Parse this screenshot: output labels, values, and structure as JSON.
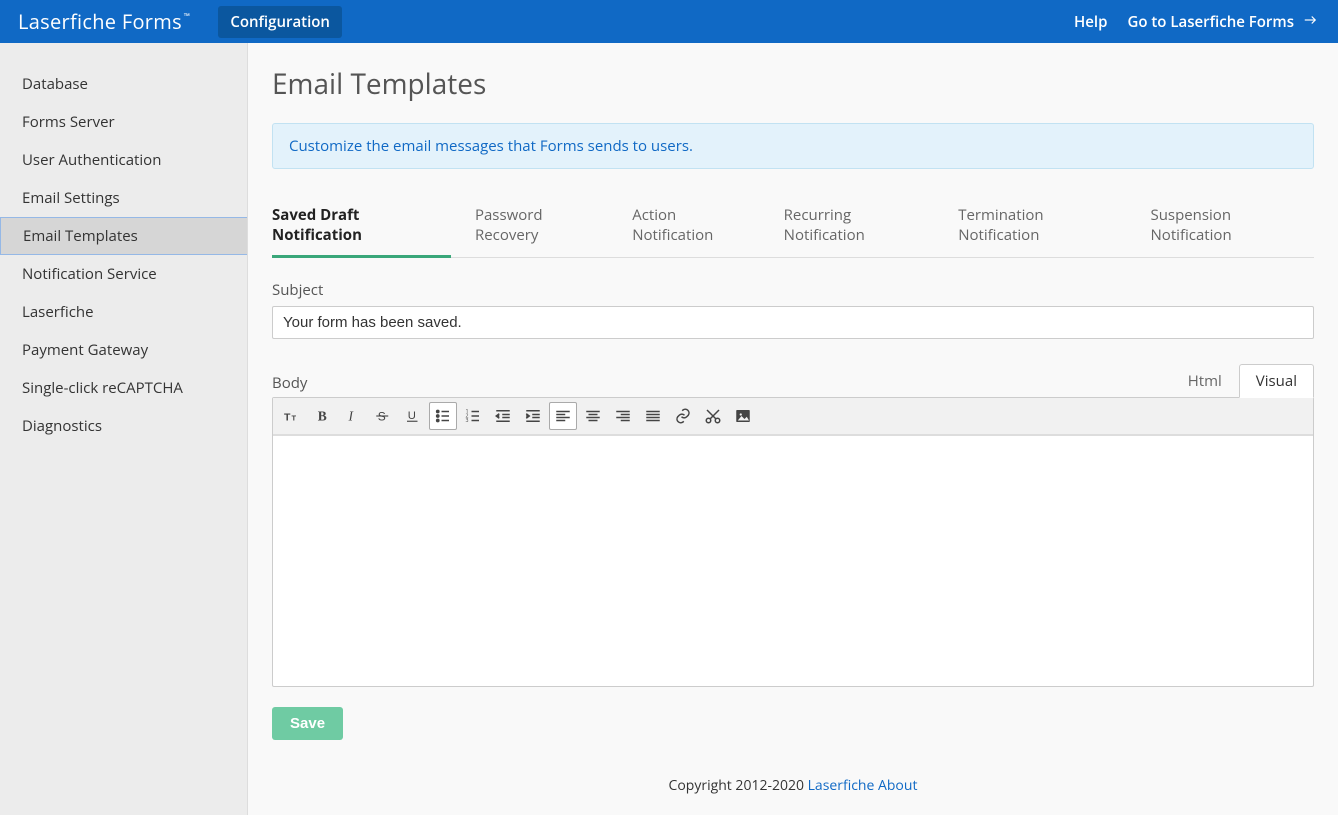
{
  "header": {
    "brand": "Laserfiche Forms",
    "trademark": "™",
    "config_button": "Configuration",
    "help": "Help",
    "goto": "Go to Laserfiche Forms"
  },
  "sidebar": {
    "items": [
      {
        "label": "Database"
      },
      {
        "label": "Forms Server"
      },
      {
        "label": "User Authentication"
      },
      {
        "label": "Email Settings"
      },
      {
        "label": "Email Templates",
        "active": true
      },
      {
        "label": "Notification Service"
      },
      {
        "label": "Laserfiche"
      },
      {
        "label": "Payment Gateway"
      },
      {
        "label": "Single-click reCAPTCHA"
      },
      {
        "label": "Diagnostics"
      }
    ]
  },
  "main": {
    "title": "Email Templates",
    "banner": "Customize the email messages that Forms sends to users.",
    "tabs": [
      {
        "label": "Saved Draft Notification",
        "active": true
      },
      {
        "label": "Password Recovery"
      },
      {
        "label": "Action Notification"
      },
      {
        "label": "Recurring Notification"
      },
      {
        "label": "Termination Notification"
      },
      {
        "label": "Suspension Notification"
      }
    ],
    "subject_label": "Subject",
    "subject_value": "Your form has been saved.",
    "body_label": "Body",
    "editor_tabs": {
      "html": "Html",
      "visual": "Visual"
    },
    "toolbar_icons": [
      "text-size-icon",
      "bold-icon",
      "italic-icon",
      "strikethrough-icon",
      "underline-icon",
      "bullet-list-icon",
      "numbered-list-icon",
      "outdent-icon",
      "indent-icon",
      "align-left-icon",
      "align-center-icon",
      "align-right-icon",
      "align-justify-icon",
      "link-icon",
      "cut-icon",
      "image-icon"
    ],
    "toolbar_active": [
      "bullet-list-icon",
      "align-left-icon"
    ],
    "save_label": "Save"
  },
  "footer": {
    "copyright": "Copyright 2012-2020 ",
    "link1": "Laserfiche",
    "link2": "About"
  }
}
